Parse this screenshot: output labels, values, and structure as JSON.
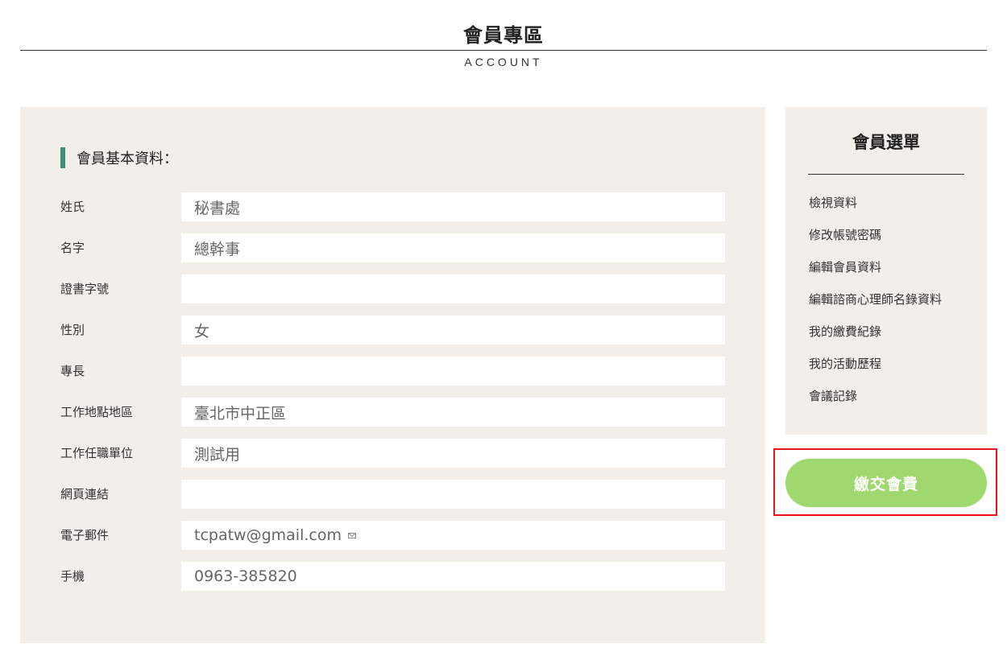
{
  "header": {
    "title": "會員專區",
    "subtitle": "ACCOUNT"
  },
  "profile": {
    "heading": "會員基本資料：",
    "fields": [
      {
        "label": "姓氏",
        "value": "秘書處"
      },
      {
        "label": "名字",
        "value": "總幹事"
      },
      {
        "label": "證書字號",
        "value": ""
      },
      {
        "label": "性別",
        "value": "女"
      },
      {
        "label": "專長",
        "value": ""
      },
      {
        "label": "工作地點地區",
        "value": "臺北市中正區"
      },
      {
        "label": "工作任職單位",
        "value": "測試用"
      },
      {
        "label": "網頁連結",
        "value": ""
      },
      {
        "label": "電子郵件",
        "value": "tcpatw@gmail.com"
      },
      {
        "label": "手機",
        "value": "0963-385820"
      }
    ],
    "accent_color": "#3f8f7d",
    "panel_color": "#f2eee9"
  },
  "sidebar": {
    "title": "會員選單",
    "items": [
      {
        "label": "檢視資料"
      },
      {
        "label": "修改帳號密碼"
      },
      {
        "label": "編輯會員資料"
      },
      {
        "label": "編輯諮商心理師名錄資料"
      },
      {
        "label": "我的繳費紀錄"
      },
      {
        "label": "我的活動歷程"
      },
      {
        "label": "會議記錄"
      }
    ]
  },
  "pay_button": {
    "label": "繳交會費",
    "color": "#9fd86e",
    "highlight_color": "#e8161c"
  },
  "icons": {
    "email": "mail-icon"
  }
}
